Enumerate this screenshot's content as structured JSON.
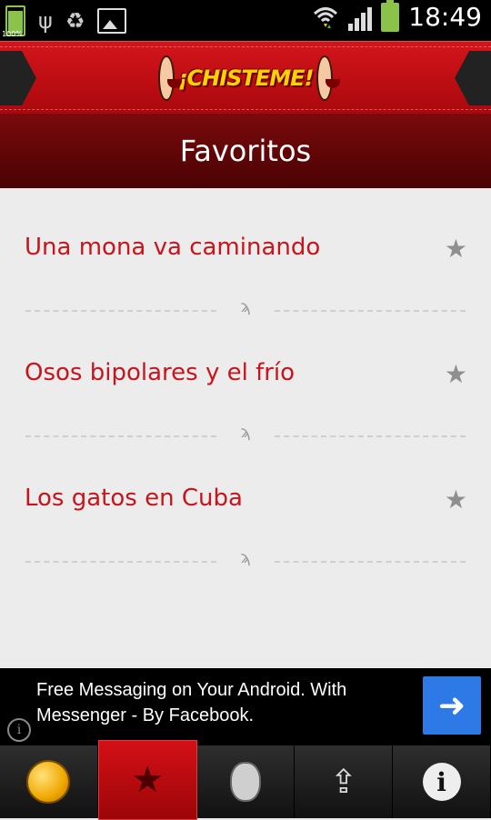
{
  "status_bar": {
    "battery_small_pct": "100%",
    "clock": "18:49"
  },
  "header": {
    "logo_text": "¡CHISTEME!"
  },
  "page": {
    "title": "Favoritos"
  },
  "favorites": [
    {
      "title": "Una mona va caminando"
    },
    {
      "title": "Osos bipolares y el frío"
    },
    {
      "title": "Los gatos en Cuba"
    }
  ],
  "ad": {
    "text": "Free Messaging on Your Android. With Messenger - By Facebook.",
    "info_glyph": "i",
    "action_glyph": "➜"
  },
  "tabs": [
    {
      "icon": "coin-icon",
      "active": false
    },
    {
      "icon": "star-icon",
      "active": true
    },
    {
      "icon": "jester-face-icon",
      "active": false
    },
    {
      "icon": "upload-icon",
      "active": false
    },
    {
      "icon": "info-icon",
      "active": false
    }
  ],
  "colors": {
    "header_red": "#d3151b",
    "title_band": "#5a0406",
    "item_text": "#c8141c",
    "ad_button": "#2d79e6"
  }
}
